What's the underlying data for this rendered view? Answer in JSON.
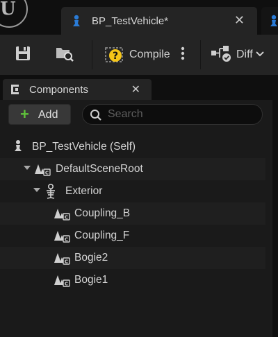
{
  "window": {
    "doc_tab_title": "BP_TestVehicle*",
    "doc_tab_close": "✕"
  },
  "toolbar": {
    "compile_label": "Compile",
    "diff_label": "Diff"
  },
  "components_panel": {
    "tab_title": "Components",
    "tab_close": "✕",
    "add_label": "Add",
    "search_placeholder": "Search",
    "search_value": ""
  },
  "tree": [
    {
      "label": "BP_TestVehicle (Self)",
      "icon": "pawn-icon",
      "depth": 0,
      "expandable": false
    },
    {
      "label": "DefaultSceneRoot",
      "icon": "scene-component-icon",
      "depth": 1,
      "expandable": true
    },
    {
      "label": "Exterior",
      "icon": "skeletal-mesh-icon",
      "depth": 2,
      "expandable": true
    },
    {
      "label": "Coupling_B",
      "icon": "scene-component-icon",
      "depth": 3,
      "expandable": false
    },
    {
      "label": "Coupling_F",
      "icon": "scene-component-icon",
      "depth": 3,
      "expandable": false
    },
    {
      "label": "Bogie2",
      "icon": "scene-component-icon",
      "depth": 3,
      "expandable": false
    },
    {
      "label": "Bogie1",
      "icon": "scene-component-icon",
      "depth": 3,
      "expandable": false
    }
  ],
  "colors": {
    "accent_blue": "#2a7bd6",
    "add_green": "#5fc23a",
    "compile_warning_yellow": "#f5c518"
  }
}
